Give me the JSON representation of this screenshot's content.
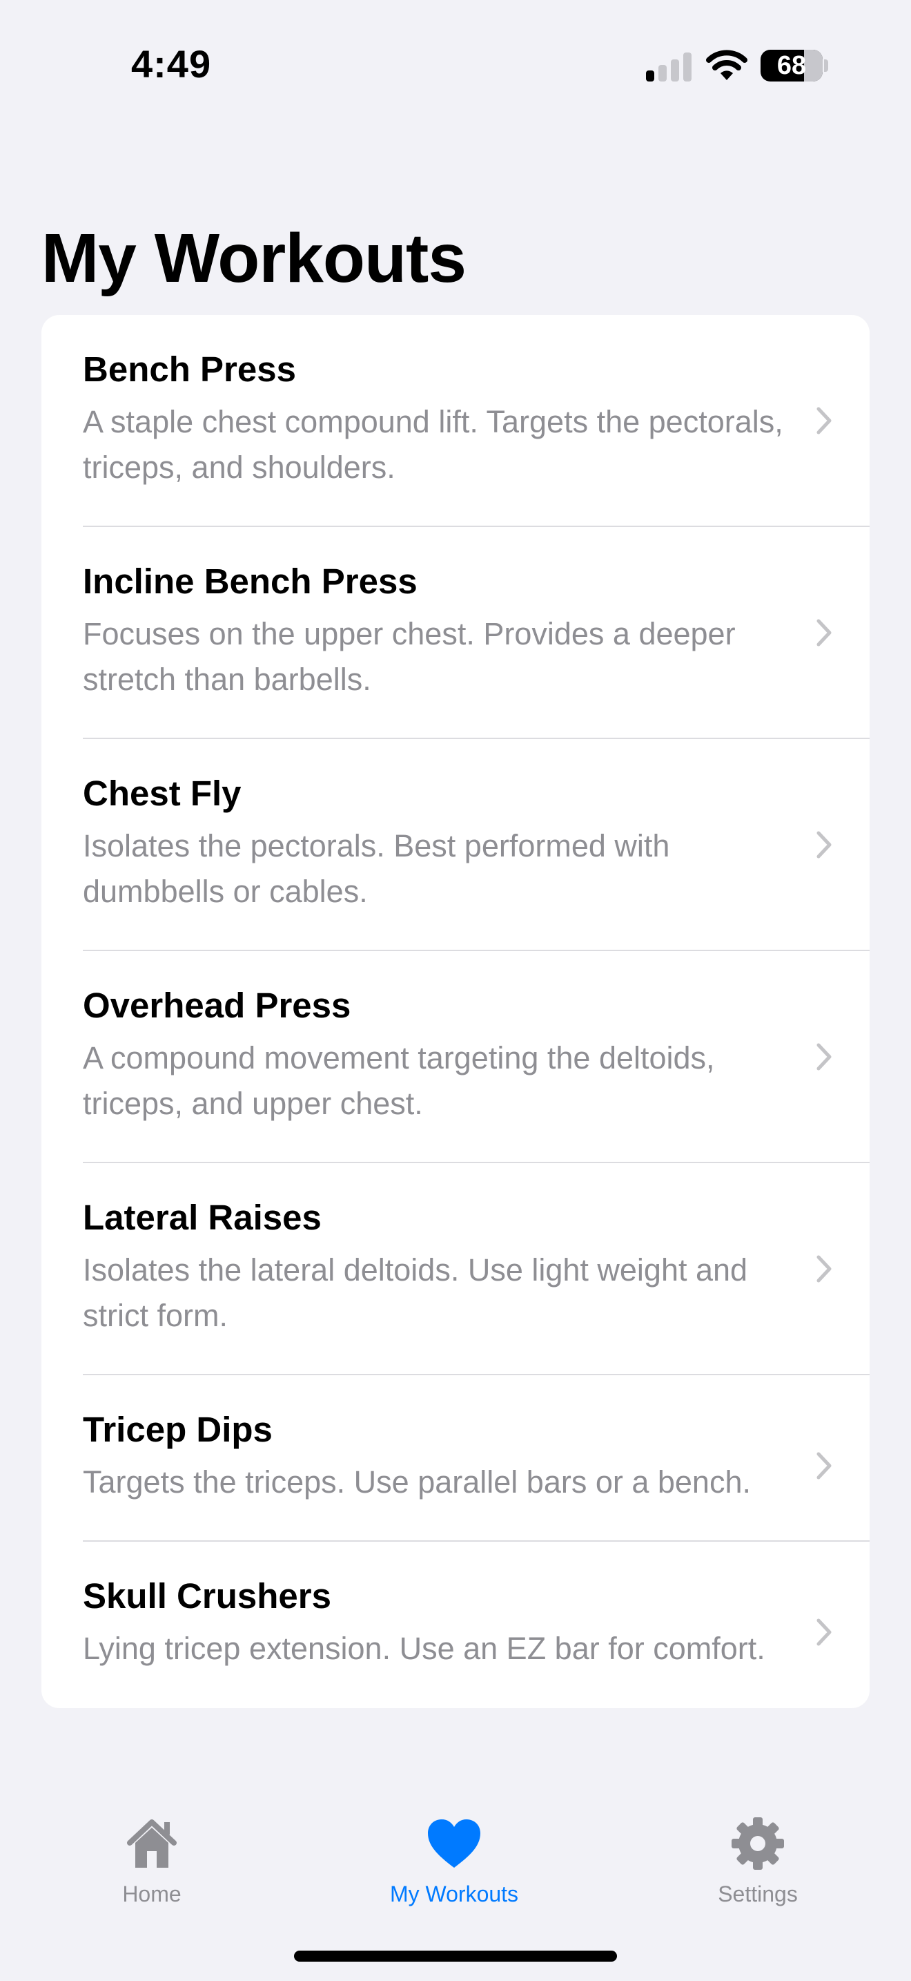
{
  "status_bar": {
    "time": "4:49",
    "battery_level": "68"
  },
  "page": {
    "title": "My Workouts"
  },
  "workouts": [
    {
      "title": "Bench Press",
      "description": "A staple chest compound lift. Targets the pectorals, triceps, and shoulders."
    },
    {
      "title": "Incline Bench Press",
      "description": "Focuses on the upper chest. Provides a deeper stretch than barbells."
    },
    {
      "title": "Chest Fly",
      "description": "Isolates the pectorals. Best performed with dumbbells or cables."
    },
    {
      "title": "Overhead Press",
      "description": "A compound movement targeting the deltoids, triceps, and upper chest."
    },
    {
      "title": "Lateral Raises",
      "description": "Isolates the lateral deltoids. Use light weight and strict form."
    },
    {
      "title": "Tricep Dips",
      "description": "Targets the triceps. Use parallel bars or a bench."
    },
    {
      "title": "Skull Crushers",
      "description": "Lying tricep extension. Use an EZ bar for comfort."
    }
  ],
  "tab_bar": {
    "tabs": [
      {
        "label": "Home",
        "icon": "house-icon",
        "active": false
      },
      {
        "label": "My Workouts",
        "icon": "heart-icon",
        "active": true
      },
      {
        "label": "Settings",
        "icon": "gear-icon",
        "active": false
      }
    ]
  },
  "colors": {
    "accent": "#007aff",
    "background": "#f2f2f7",
    "secondary_text": "#8e8e93",
    "inactive_tab": "#8e8e93"
  }
}
